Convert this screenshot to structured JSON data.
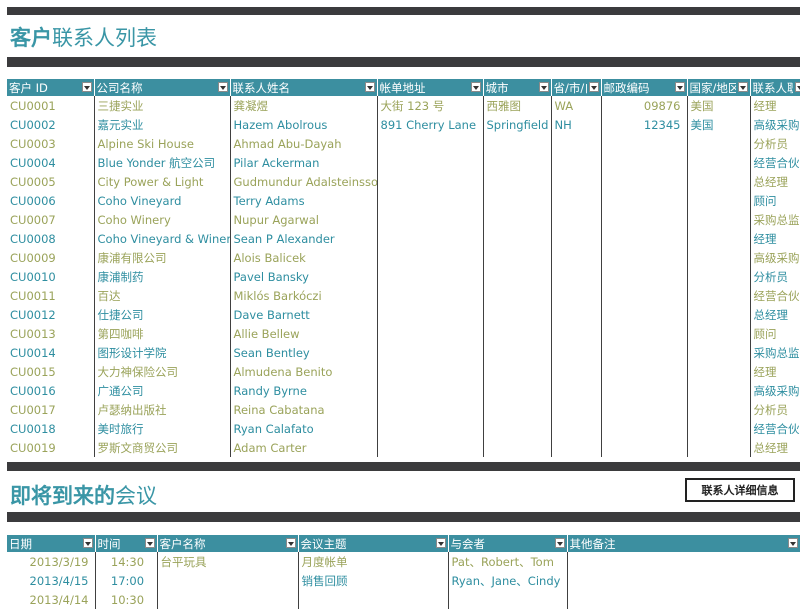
{
  "contacts": {
    "title_bold": "客户",
    "title_rest": "联系人列表",
    "columns": [
      "客户 ID",
      "公司名称",
      "联系人姓名",
      "帐单地址",
      "城市",
      "省/市/自",
      "邮政编码",
      "国家/地区",
      "联系人职"
    ],
    "rows": [
      [
        "CU0001",
        "三捷实业",
        "龚凝煜",
        "大街 123 号",
        "西雅图",
        "WA",
        "09876",
        "美国",
        "经理"
      ],
      [
        "CU0002",
        "嘉元实业",
        "Hazem Abolrous",
        "891 Cherry Lane",
        "Springfield",
        "NH",
        "12345",
        "美国",
        "高级采购"
      ],
      [
        "CU0003",
        "Alpine Ski House",
        "Ahmad Abu-Dayah",
        "",
        "",
        "",
        "",
        "",
        "分析员"
      ],
      [
        "CU0004",
        "Blue Yonder 航空公司",
        "Pilar Ackerman",
        "",
        "",
        "",
        "",
        "",
        "经营合伙"
      ],
      [
        "CU0005",
        "City Power & Light",
        "Gudmundur Adalsteinsson",
        "",
        "",
        "",
        "",
        "",
        "总经理"
      ],
      [
        "CU0006",
        "Coho Vineyard",
        "Terry Adams",
        "",
        "",
        "",
        "",
        "",
        "顾问"
      ],
      [
        "CU0007",
        "Coho Winery",
        "Nupur Agarwal",
        "",
        "",
        "",
        "",
        "",
        "采购总监"
      ],
      [
        "CU0008",
        "Coho Vineyard & Winery",
        "Sean P Alexander",
        "",
        "",
        "",
        "",
        "",
        "经理"
      ],
      [
        "CU0009",
        "康浦有限公司",
        "Alois Balicek",
        "",
        "",
        "",
        "",
        "",
        "高级采购"
      ],
      [
        "CU0010",
        "康浦制药",
        "Pavel Bansky",
        "",
        "",
        "",
        "",
        "",
        "分析员"
      ],
      [
        "CU0011",
        "百达",
        "Miklós Barkóczi",
        "",
        "",
        "",
        "",
        "",
        "经营合伙"
      ],
      [
        "CU0012",
        "仕捷公司",
        "Dave Barnett",
        "",
        "",
        "",
        "",
        "",
        "总经理"
      ],
      [
        "CU0013",
        "第四咖啡",
        "Allie Bellew",
        "",
        "",
        "",
        "",
        "",
        "顾问"
      ],
      [
        "CU0014",
        "图形设计学院",
        "Sean Bentley",
        "",
        "",
        "",
        "",
        "",
        "采购总监"
      ],
      [
        "CU0015",
        "大力神保险公司",
        "Almudena Benito",
        "",
        "",
        "",
        "",
        "",
        "经理"
      ],
      [
        "CU0016",
        "广通公司",
        "Randy Byrne",
        "",
        "",
        "",
        "",
        "",
        "高级采购"
      ],
      [
        "CU0017",
        "卢瑟纳出版社",
        "Reina Cabatana",
        "",
        "",
        "",
        "",
        "",
        "分析员"
      ],
      [
        "CU0018",
        "美时旅行",
        "Ryan Calafato",
        "",
        "",
        "",
        "",
        "",
        "经营合伙"
      ],
      [
        "CU0019",
        "罗斯文商贸公司",
        "Adam Carter",
        "",
        "",
        "",
        "",
        "",
        "总经理"
      ]
    ]
  },
  "meetings": {
    "title_bold": "即将到来的",
    "title_rest": "会议",
    "detail_button": "联系人详细信息",
    "columns": [
      "日期",
      "时间",
      "客户名称",
      "会议主题",
      "与会者",
      "其他备注"
    ],
    "rows": [
      [
        "2013/3/19",
        "14:30",
        "台平玩具",
        "月度帐单",
        "Pat、Robert、Tom",
        ""
      ],
      [
        "2013/4/15",
        "17:00",
        "",
        "销售回顾",
        "Ryan、Jane、Cindy",
        ""
      ],
      [
        "2013/4/14",
        "10:30",
        "",
        "",
        "",
        ""
      ]
    ]
  },
  "colors": {
    "accent": "#3a96a6",
    "header": "#3c8fa0",
    "bar": "#3b3b3d",
    "odd_text": "#9aa35a",
    "even_text": "#2e8ea0"
  }
}
